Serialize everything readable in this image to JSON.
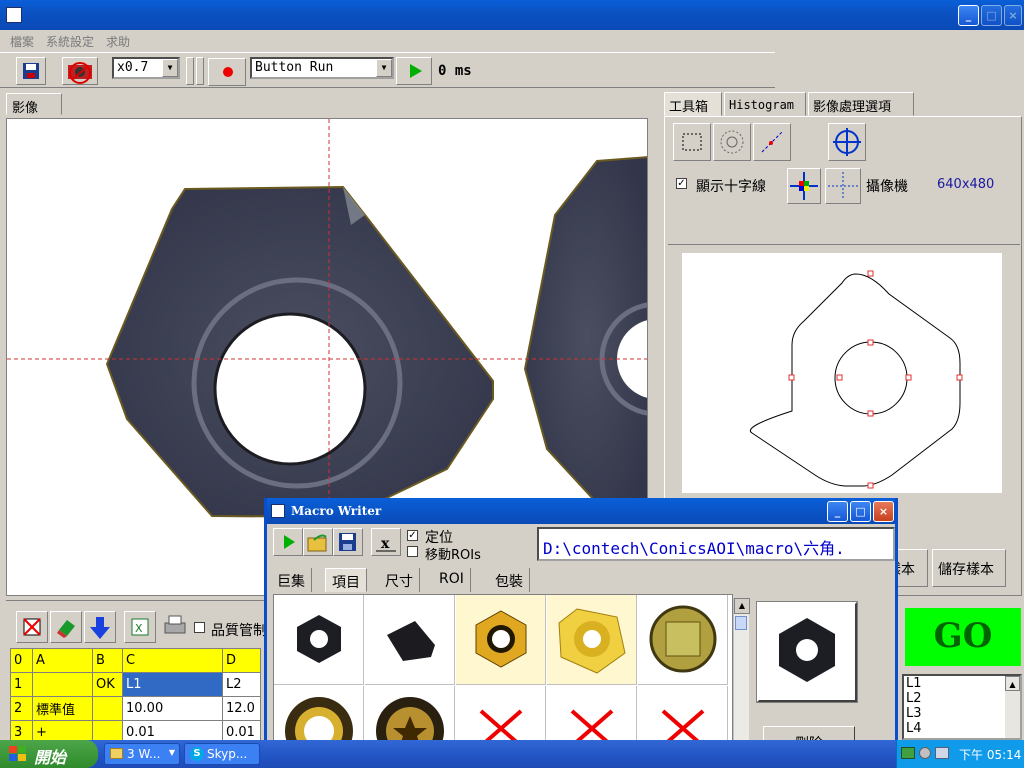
{
  "window": {
    "title": ""
  },
  "menu": {
    "items": [
      "檔案",
      "系統設定",
      "求助"
    ]
  },
  "toolbar": {
    "zoom": "x0.7",
    "run_mode": "Button Run",
    "time": "0 ms"
  },
  "image_tab": {
    "label": "影像"
  },
  "right_tabs": [
    "工具箱",
    "Histogram",
    "影像處理選項"
  ],
  "right_panel": {
    "crosshair_label": "顯示十字線",
    "crosshair_checked": true,
    "camera_label": "攝像機",
    "resolution": "640x480",
    "partial_button": "樣本",
    "save_sample_button": "儲存樣本",
    "status": "GO",
    "list_items": [
      "L1",
      "L2",
      "L3",
      "L4"
    ]
  },
  "grid_toolbar": {
    "quality_label": "品質管制"
  },
  "grid": {
    "headers": [
      "0",
      "A",
      "B",
      "C",
      "D"
    ],
    "rows": [
      [
        "1",
        "",
        "OK",
        "L1",
        "L2"
      ],
      [
        "2",
        "標準值",
        "",
        "10.00",
        "12.0"
      ],
      [
        "3",
        "+",
        "",
        "0.01",
        "0.01"
      ]
    ]
  },
  "macro": {
    "title": "Macro Writer",
    "positioning_label": "定位",
    "move_rois_label": "移動ROIs",
    "path": "D:\\contech\\ConicsAOI\\macro\\六角.",
    "tabs": [
      "巨集",
      "項目",
      "尺寸",
      "ROI",
      "包裝"
    ],
    "delete_button": "刪除"
  },
  "taskbar": {
    "start_label": "開始",
    "items": [
      "3 W...",
      "Skyp..."
    ],
    "clock": "下午 05:14"
  },
  "colors": {
    "titlebar": "#0a55c9",
    "go_green": "#00ff00",
    "go_text": "#006400",
    "grid_yellow": "#ffff00",
    "path_blue": "#0000cc"
  }
}
